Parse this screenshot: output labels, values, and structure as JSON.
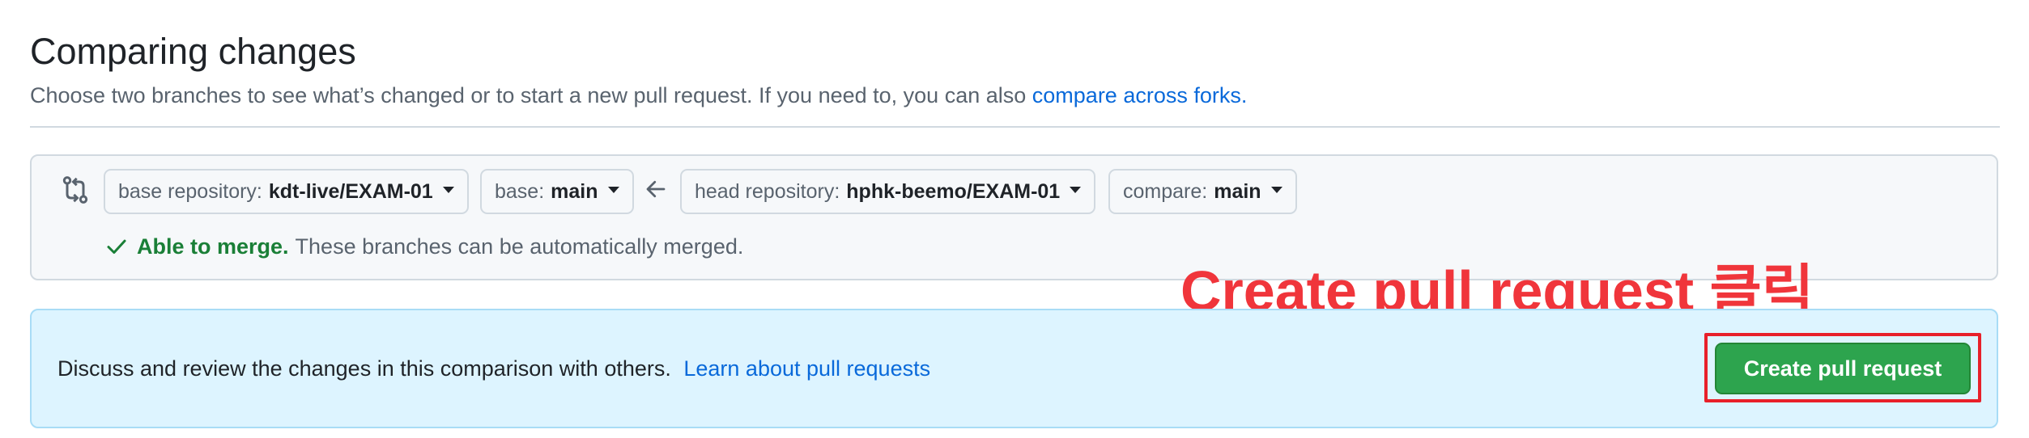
{
  "header": {
    "title": "Comparing changes",
    "subtitle": "Choose two branches to see what’s changed or to start a new pull request. If you need to, you can also",
    "subtitle_link": "compare across forks."
  },
  "range": {
    "base_repository": {
      "label": "base repository:",
      "value": "kdt-live/EXAM-01"
    },
    "base": {
      "label": "base:",
      "value": "main"
    },
    "head_repository": {
      "label": "head repository:",
      "value": "hphk-beemo/EXAM-01"
    },
    "compare": {
      "label": "compare:",
      "value": "main"
    },
    "merge_ok": "Able to merge.",
    "merge_desc": "These branches can be automatically merged."
  },
  "annotation": {
    "text": "Create pull request 클릭",
    "color": "#f0353b"
  },
  "discuss": {
    "text": "Discuss and review the changes in this comparison with others.",
    "link": "Learn about pull requests",
    "button": "Create pull request"
  },
  "icons": {
    "compare": "git-compare-icon",
    "arrow": "arrow-left-icon",
    "check": "check-icon"
  },
  "colors": {
    "link": "#0969da",
    "success": "#1a7f37",
    "button": "#2da44e",
    "highlight": "#e8202a",
    "info_bg": "#ddf4ff"
  }
}
